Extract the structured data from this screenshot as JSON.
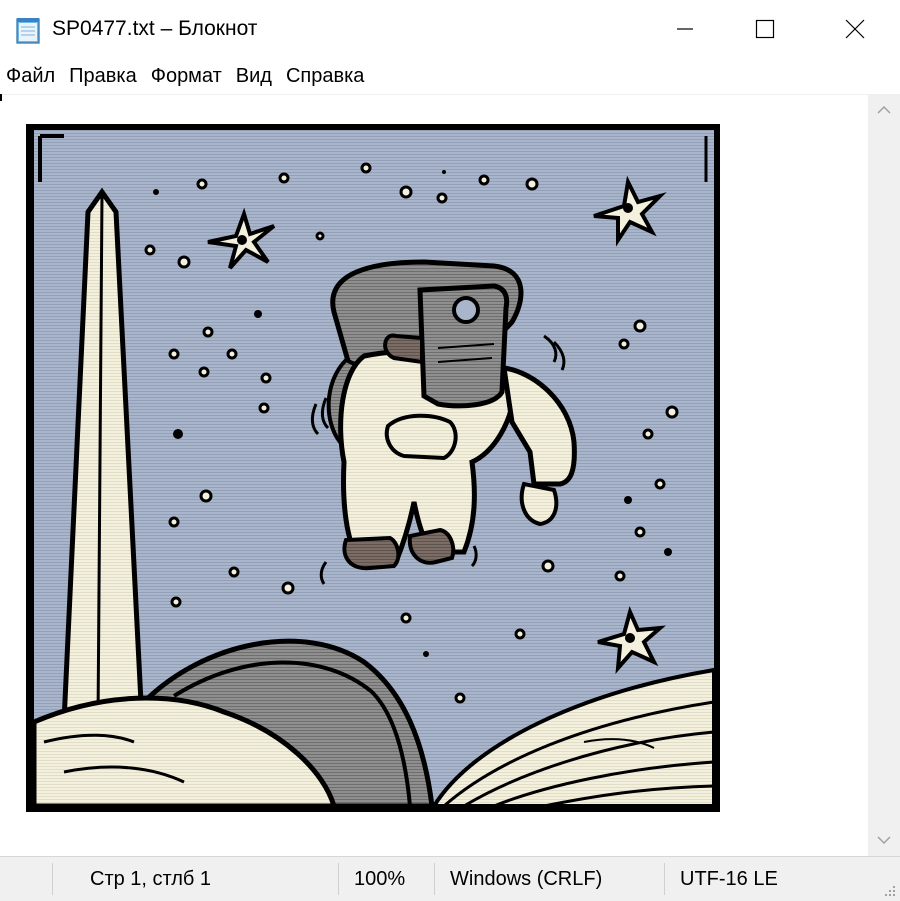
{
  "window": {
    "title": "SP0477.txt – Блокнот",
    "icon": "notepad-icon"
  },
  "controls": {
    "minimize_icon": "minimize-icon",
    "maximize_icon": "maximize-icon",
    "close_icon": "close-icon"
  },
  "menu": {
    "items": [
      {
        "label": "Файл"
      },
      {
        "label": "Правка"
      },
      {
        "label": "Формат"
      },
      {
        "label": "Вид"
      },
      {
        "label": "Справка"
      }
    ]
  },
  "status": {
    "position": "Стр 1, стлб 1",
    "zoom": "100%",
    "line_endings": "Windows (CRLF)",
    "encoding": "UTF-16 LE"
  },
  "colors": {
    "sky": "#a7b3c8",
    "outline": "#000000",
    "cream": "#f3efdc",
    "gray": "#8a8a8a",
    "brown": "#7a6a62"
  }
}
